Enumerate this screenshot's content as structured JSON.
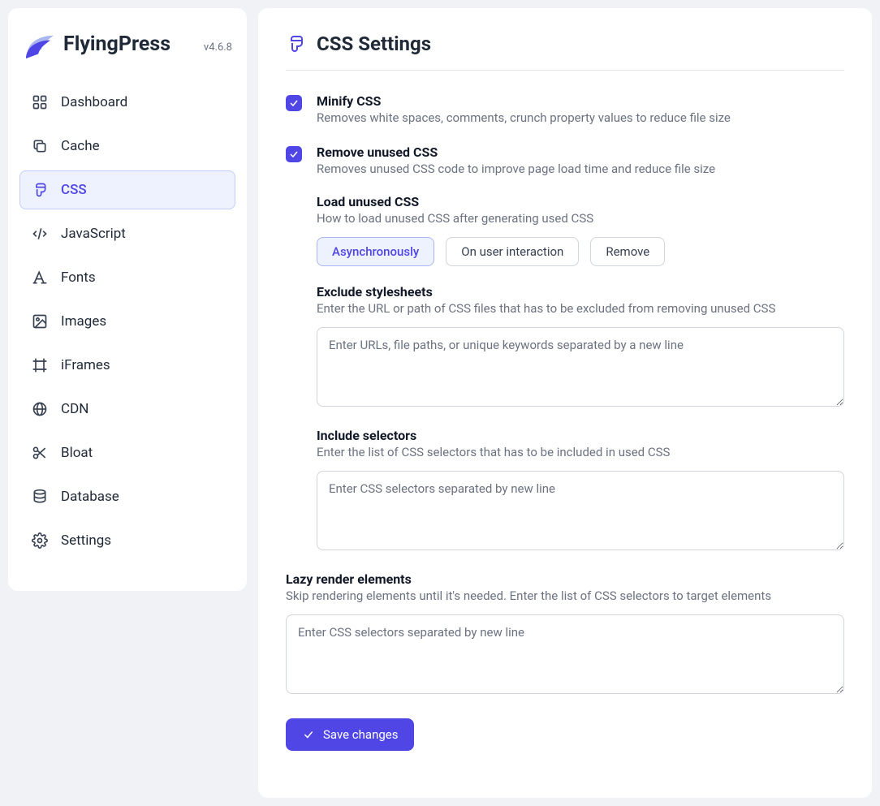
{
  "brand": {
    "title": "FlyingPress",
    "version": "v4.6.8"
  },
  "sidebar": {
    "items": [
      {
        "label": "Dashboard",
        "icon": "dashboard"
      },
      {
        "label": "Cache",
        "icon": "copy"
      },
      {
        "label": "CSS",
        "icon": "brush",
        "active": true
      },
      {
        "label": "JavaScript",
        "icon": "code"
      },
      {
        "label": "Fonts",
        "icon": "font"
      },
      {
        "label": "Images",
        "icon": "image"
      },
      {
        "label": "iFrames",
        "icon": "frame"
      },
      {
        "label": "CDN",
        "icon": "globe"
      },
      {
        "label": "Bloat",
        "icon": "scissors"
      },
      {
        "label": "Database",
        "icon": "database"
      },
      {
        "label": "Settings",
        "icon": "gear"
      }
    ]
  },
  "page": {
    "title": "CSS Settings"
  },
  "settings": {
    "minify": {
      "title": "Minify CSS",
      "desc": "Removes white spaces, comments, crunch property values to reduce file size",
      "checked": true
    },
    "remove_unused": {
      "title": "Remove unused CSS",
      "desc": "Removes unused CSS code to improve page load time and reduce file size",
      "checked": true
    },
    "load_unused": {
      "title": "Load unused CSS",
      "desc": "How to load unused CSS after generating used CSS",
      "options": {
        "async": "Asynchronously",
        "interaction": "On user interaction",
        "remove": "Remove"
      },
      "selected": "async"
    },
    "exclude": {
      "title": "Exclude stylesheets",
      "desc": "Enter the URL or path of CSS files that has to be excluded from removing unused CSS",
      "placeholder": "Enter URLs, file paths, or unique keywords separated by a new line",
      "value": ""
    },
    "include": {
      "title": "Include selectors",
      "desc": "Enter the list of CSS selectors that has to be included in used CSS",
      "placeholder": "Enter CSS selectors separated by new line",
      "value": ""
    },
    "lazy": {
      "title": "Lazy render elements",
      "desc": "Skip rendering elements until it's needed. Enter the list of CSS selectors to target elements",
      "placeholder": "Enter CSS selectors separated by new line",
      "value": ""
    }
  },
  "actions": {
    "save": "Save changes"
  },
  "colors": {
    "primary": "#4f46e5",
    "muted": "#6b7280"
  }
}
